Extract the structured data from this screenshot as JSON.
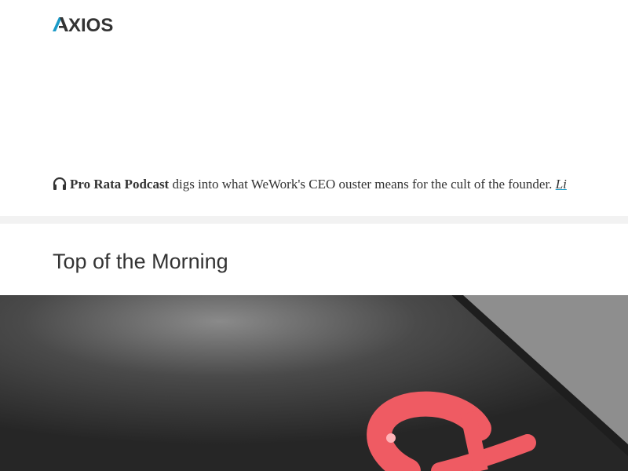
{
  "brand": {
    "logo_text": "AXIOS",
    "accent_color": "#1a9ac7",
    "text_color": "#333333"
  },
  "podcast": {
    "icon": "headphones-icon",
    "show_name": "Pro Rata Podcast",
    "description": "digs into what WeWork's CEO ouster means for the cult of the founder.",
    "link_text": "Li"
  },
  "section": {
    "title": "Top of the Morning"
  },
  "hero_image": {
    "subject": "dollar-sign-illustration",
    "colors": {
      "background": "#8e8e8e",
      "dark_surface": "#2a2a2a",
      "symbol": "#ef5b63"
    }
  }
}
